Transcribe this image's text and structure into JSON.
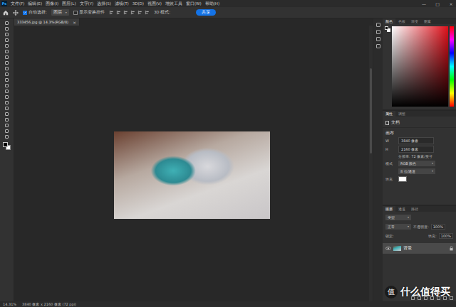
{
  "app": {
    "logo": "Ps"
  },
  "menu": [
    "文件(F)",
    "编辑(E)",
    "图像(I)",
    "图层(L)",
    "文字(Y)",
    "选择(S)",
    "滤镜(T)",
    "3D(D)",
    "视图(V)",
    "增效工具",
    "窗口(W)",
    "帮助(H)"
  ],
  "window_controls": [
    "—",
    "□",
    "×"
  ],
  "options_bar": {
    "auto_select_label": "自动选择:",
    "auto_select_checked": true,
    "target": "图层",
    "show_transform": "显示变换控件",
    "show_transform_checked": false,
    "mode_3d": "3D 模式:",
    "share_button": "共享"
  },
  "document_tab": {
    "title": "333456.jpg @ 14.3%(RGB/8)",
    "close": "×"
  },
  "color_panel": {
    "tabs": [
      {
        "label": "颜色",
        "selected": true
      },
      {
        "label": "色板",
        "selected": false
      },
      {
        "label": "渐变",
        "selected": false
      },
      {
        "label": "图案",
        "selected": false
      }
    ]
  },
  "properties_panel": {
    "tabs": [
      {
        "label": "属性",
        "selected": true
      },
      {
        "label": "调整",
        "selected": false
      }
    ],
    "section_title": "文档",
    "canvas_title": "画布",
    "fields": [
      {
        "label": "W",
        "value": "3840 像素"
      },
      {
        "label": "H",
        "value": "2160 像素"
      }
    ],
    "resolution": "分辨率: 72 像素/英寸",
    "mode_label": "模式",
    "mode_value": "RGB 颜色",
    "depth_value": "8 位/通道",
    "fill_label": "填充"
  },
  "layers_panel": {
    "tabs": [
      {
        "label": "图层",
        "selected": true
      },
      {
        "label": "通道",
        "selected": false
      },
      {
        "label": "路径",
        "selected": false
      }
    ],
    "filter": "类型",
    "blend": "正常",
    "opacity_label": "不透明度:",
    "opacity": "100%",
    "lock_label": "锁定:",
    "fill_label": "填充:",
    "fill": "100%",
    "layers": [
      {
        "name": "背景",
        "visible": true,
        "selected": true,
        "locked": true
      }
    ]
  },
  "status_bar": {
    "zoom": "14.31%",
    "info": "3840 像素 x 2160 像素 (72 ppi)"
  },
  "watermark": {
    "badge": "值",
    "text": "什么值得买"
  }
}
